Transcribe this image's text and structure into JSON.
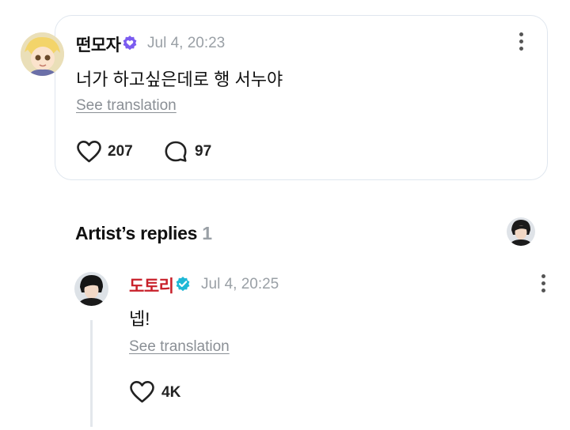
{
  "fan_post": {
    "author": "떤모자",
    "timestamp": "Jul 4, 20:23",
    "text": "너가 하고싶은데로 행 서누야",
    "see_translation": "See translation",
    "likes": "207",
    "comments": "97"
  },
  "artist_replies": {
    "title": "Artist’s replies",
    "count": "1"
  },
  "artist_reply": {
    "author": "도토리",
    "timestamp": "Jul 4, 20:25",
    "text": "넵!",
    "see_translation": "See translation",
    "likes": "4K"
  },
  "colors": {
    "artist_name": "#c8202a",
    "verified_fan_badge": "#7b5cf0",
    "verified_artist_badge": "#1fb8d6",
    "muted_text": "#9aa0a6"
  },
  "icons": [
    "verified-badge-icon",
    "heart-icon",
    "comment-bubble-icon",
    "more-options-icon"
  ]
}
